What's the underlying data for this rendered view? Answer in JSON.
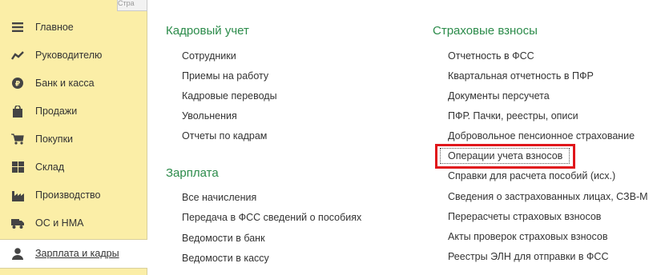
{
  "sidebar": {
    "tab_label": "Стра",
    "items": [
      {
        "label": "Главное",
        "icon": "hamburger-menu-icon"
      },
      {
        "label": "Руководителю",
        "icon": "trend-chart-icon"
      },
      {
        "label": "Банк и касса",
        "icon": "ruble-coin-icon"
      },
      {
        "label": "Продажи",
        "icon": "shopping-bag-icon"
      },
      {
        "label": "Покупки",
        "icon": "shopping-cart-icon"
      },
      {
        "label": "Склад",
        "icon": "warehouse-grid-icon"
      },
      {
        "label": "Производство",
        "icon": "factory-icon"
      },
      {
        "label": "ОС и НМА",
        "icon": "truck-icon"
      },
      {
        "label": "Зарплата и кадры",
        "icon": "person-icon",
        "active": true
      }
    ]
  },
  "main": {
    "kadry": {
      "title": "Кадровый учет",
      "links": [
        "Сотрудники",
        "Приемы на работу",
        "Кадровые переводы",
        "Увольнения",
        "Отчеты по кадрам"
      ]
    },
    "zarplata": {
      "title": "Зарплата",
      "links": [
        "Все начисления",
        "Передача в ФСС сведений о пособиях",
        "Ведомости в банк",
        "Ведомости в кассу"
      ]
    },
    "vznosy": {
      "title": "Страховые взносы",
      "links": [
        "Отчетность в ФСС",
        "Квартальная отчетность в ПФР",
        "Документы персучета",
        "ПФР. Пачки, реестры, описи",
        "Добровольное пенсионное страхование",
        "Операции учета взносов",
        "Справки для расчета пособий (исх.)",
        "Сведения о застрахованных лицах, СЗВ-М",
        "Перерасчеты страховых взносов",
        "Акты проверок страховых взносов",
        "Реестры ЭЛН для отправки в ФСС"
      ]
    }
  },
  "colors": {
    "sidebar_bg": "#fbeea7",
    "section_title": "#2b8b4a",
    "highlight": "#e0161b"
  }
}
